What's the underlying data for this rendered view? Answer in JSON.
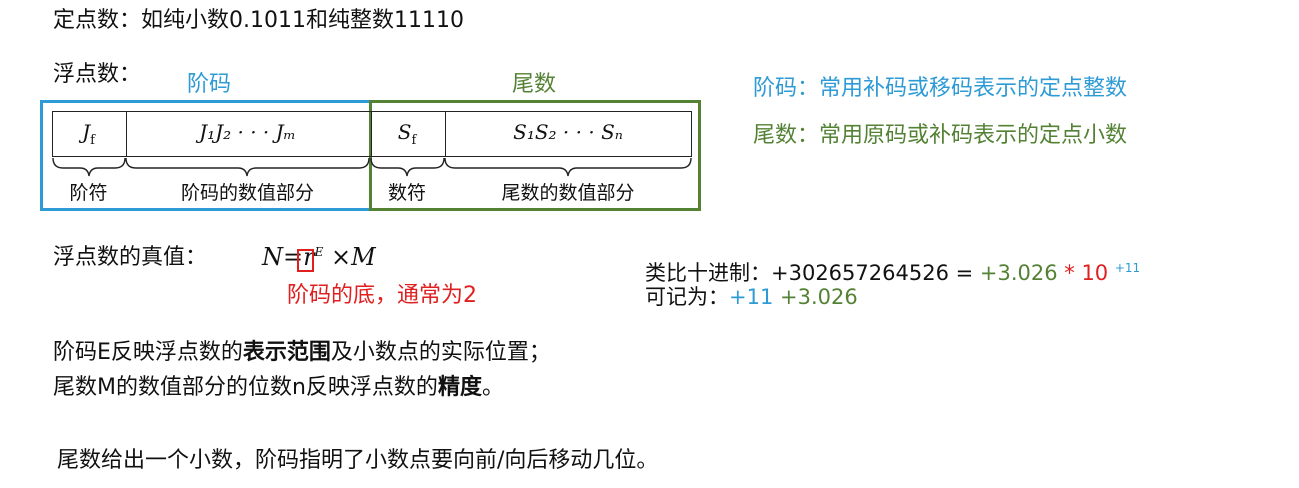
{
  "colors": {
    "blue": "#2e9bd6",
    "green": "#548235",
    "red": "#e02020"
  },
  "line1": "定点数：如纯小数0.1011和纯整数11110",
  "float_label": "浮点数：",
  "diagram": {
    "exponent_title": "阶码",
    "mantissa_title": "尾数",
    "fields": [
      {
        "main": "J",
        "sub": "f"
      },
      {
        "text": "J₁J₂ · · · Jₘ"
      },
      {
        "main": "S",
        "sub": "f"
      },
      {
        "text": "S₁S₂ · · · Sₙ"
      }
    ],
    "under": [
      "阶符",
      "阶码的数值部分",
      "数符",
      "尾数的数值部分"
    ]
  },
  "notes": {
    "exponent": "阶码：常用补码或移码表示的定点整数",
    "mantissa": "尾数：常用原码或补码表示的定点小数"
  },
  "true_value": {
    "label": "浮点数的真值：",
    "formula_n": "N",
    "formula_eq": "=",
    "formula_r": "r",
    "formula_e": "E",
    "formula_times": "×",
    "formula_m": "M",
    "annotation": "阶码的底，通常为2"
  },
  "analogy": {
    "prefix": "类比十进制：+302657264526  = ",
    "mantissa": "+3.026",
    "star": " * 10 ",
    "exp": "+11",
    "record_prefix": "可记为：",
    "record_exp": "+11",
    "record_mantissa": "+3.026"
  },
  "statements": {
    "s1_a": "阶码E反映浮点数的",
    "s1_b": "表示范围",
    "s1_c": "及小数点的实际位置；",
    "s2_a": "尾数M的数值部分的位数n反映浮点数的",
    "s2_b": "精度",
    "s2_c": "。",
    "s3": "尾数给出一个小数，阶码指明了小数点要向前/向后移动几位。"
  }
}
